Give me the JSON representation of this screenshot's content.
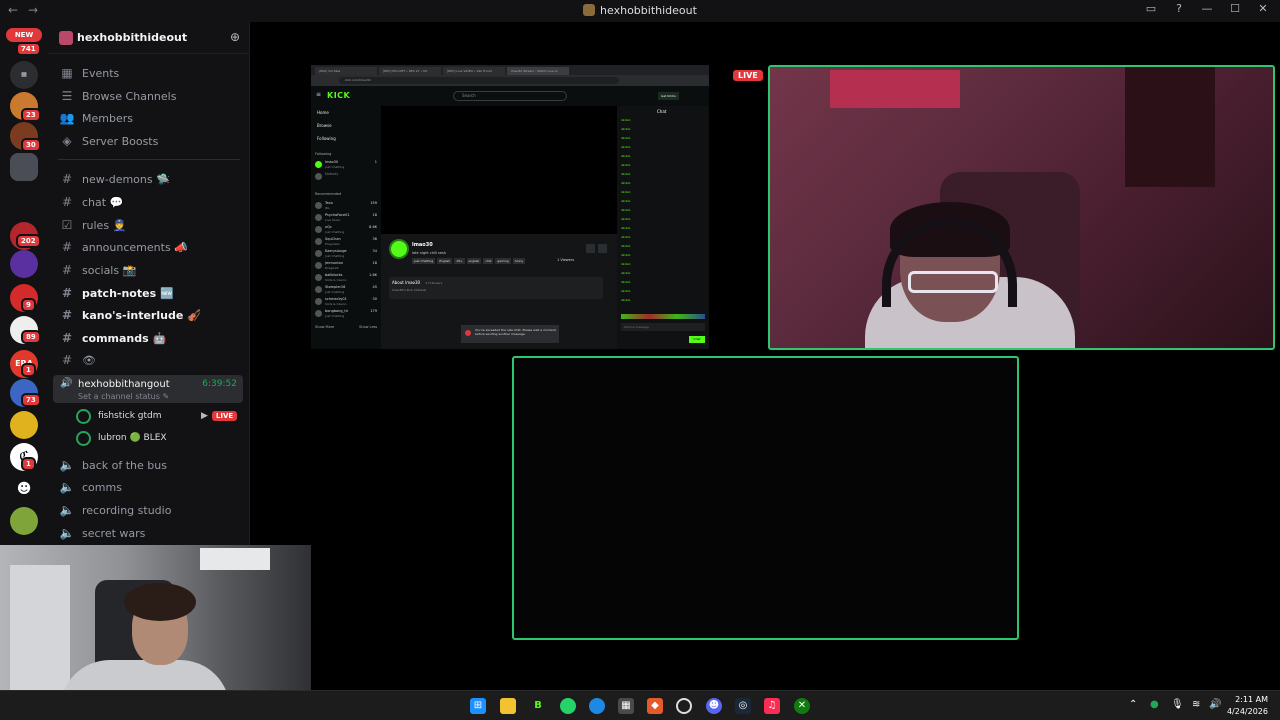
{
  "window": {
    "title": "hexhobbithideout"
  },
  "rail": {
    "new_label": "NEW",
    "new_count": "741",
    "servers": [
      {
        "name": "server-1",
        "badge": ""
      },
      {
        "name": "server-2",
        "badge": "23"
      },
      {
        "name": "server-3",
        "badge": "30"
      },
      {
        "name": "server-4",
        "badge": ""
      },
      {
        "name": "server-5",
        "badge": "202"
      },
      {
        "name": "server-6",
        "badge": ""
      },
      {
        "name": "server-7",
        "badge": "9"
      },
      {
        "name": "server-8",
        "badge": "89"
      },
      {
        "name": "server-9",
        "badge": "1"
      },
      {
        "name": "server-10",
        "badge": "73"
      },
      {
        "name": "server-11",
        "badge": "1"
      },
      {
        "name": "server-12",
        "badge": "1"
      }
    ]
  },
  "sidebar": {
    "server_name": "hexhobbithideout",
    "menu": [
      "Events",
      "Browse Channels",
      "Members",
      "Server Boosts"
    ],
    "channels": [
      {
        "name": "new-demons 🛸",
        "bold": false
      },
      {
        "name": "chat 💬",
        "bold": false
      },
      {
        "name": "rules 👮",
        "bold": false
      },
      {
        "name": "announcements 📣",
        "bold": false
      },
      {
        "name": "socials 📸",
        "bold": false
      },
      {
        "name": "patch-notes 🆕",
        "bold": true
      },
      {
        "name": "kano's-interlude 🎻",
        "bold": true
      },
      {
        "name": "commands 🤖",
        "bold": true
      },
      {
        "name": "👁",
        "bold": false
      }
    ],
    "active_voice": {
      "name": "hexhobbithangout",
      "timer": "6:39:52",
      "status": "Set a channel status ✎"
    },
    "voice_users": [
      {
        "name": "fishstick gtdm",
        "live": "LIVE"
      },
      {
        "name": "lubron 🟢 BLEX",
        "live": ""
      }
    ],
    "voice_channels": [
      "back of the bus",
      "comms",
      "recording studio",
      "secret wars"
    ]
  },
  "stream": {
    "tabs": [
      "(800) YouTube",
      "[REC] Mini NFT • RES 27 • Kit",
      "[REC] Live VIDEO • k9k Fi.Inst",
      "lmao30 Stream - Watch Live on"
    ],
    "url": "kick.com/lmao30",
    "logo": "KICK",
    "search_placeholder": "Search",
    "get_button": "Get KICKs",
    "nav": [
      "Home",
      "Browse",
      "Following"
    ],
    "following_label": "Following",
    "recommended_label": "Recommended",
    "following": [
      {
        "name": "lmao30",
        "cat": "Just Chatting",
        "viewers": "1"
      },
      {
        "name": "Nobody",
        "cat": "",
        "viewers": ""
      }
    ],
    "recommended": [
      {
        "name": "Taco",
        "cat": "IRL",
        "viewers": "159"
      },
      {
        "name": "PsychoFace01",
        "cat": "Live Music",
        "viewers": "18"
      },
      {
        "name": "xQc",
        "cat": "Just Chatting",
        "viewers": "8.6K"
      },
      {
        "name": "SquChan",
        "cat": "Pragmata",
        "viewers": "36"
      },
      {
        "name": "Kaeryslouge",
        "cat": "Just Chatting",
        "viewers": "34"
      },
      {
        "name": "jmmunton",
        "cat": "Dragbalk",
        "viewers": "18"
      },
      {
        "name": "ballblocks",
        "cat": "Slots & Casino",
        "viewers": "1.6K"
      },
      {
        "name": "Stompler16",
        "cat": "Just Chatting",
        "viewers": "45"
      },
      {
        "name": "schmecky01",
        "cat": "Slots & Casino",
        "viewers": "30"
      },
      {
        "name": "bongbong_tri",
        "cat": "Just Chatting",
        "viewers": "179"
      }
    ],
    "show_more": "Show More",
    "show_less": "Show Less",
    "channel": {
      "name": "lmao30",
      "title": "late night chill sesh",
      "tags": [
        "Just Chatting",
        "English",
        "18+",
        "english",
        "chill",
        "gaming",
        "funny"
      ],
      "viewers": "1 Viewers",
      "about": "About lmao30",
      "followers": "2 Followers",
      "about_sub": "lmao30's Kick Channel"
    },
    "toast": "You've exceeded the rate limit. Please wait a moment before sending another message.",
    "chat_header": "Chat",
    "chat_user": "4kdub",
    "chat_placeholder": "Send a message",
    "chat_button": "Chat"
  },
  "stage": {
    "live_label": "LIVE"
  },
  "taskbar": {
    "apps": [
      "start",
      "file-explorer",
      "b-app",
      "whatsapp",
      "edge",
      "store",
      "brave",
      "obs",
      "discord",
      "steam",
      "music",
      "xbox"
    ],
    "time": "2:11 AM",
    "date": "4/24/2026"
  }
}
